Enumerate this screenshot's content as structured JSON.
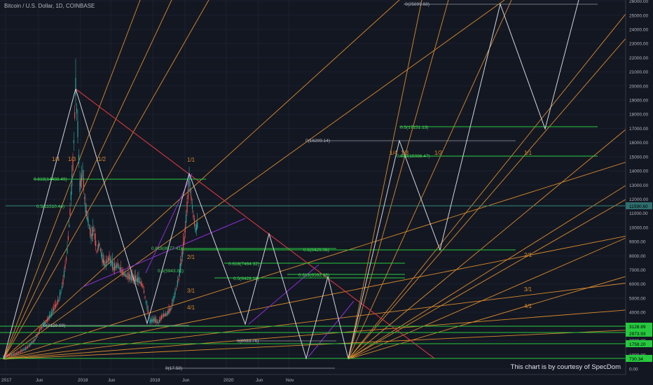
{
  "header": {
    "title": "Bitcoin / U.S. Dollar, 1D, COINBASE"
  },
  "footer": {
    "credit": "This chart is by courtesy of SpecDom"
  },
  "colors": {
    "background": "#131722",
    "price_candles_up": "#26a69a",
    "price_candles_down": "#ef5350",
    "fan": "#d98b2b",
    "fib_green": "#27c93f",
    "projection": "#d1d4dc",
    "trendline_red": "#d9363e",
    "channel_purple": "#8c2fd6",
    "current_price_label": "#2f6f6f"
  },
  "chart_data": {
    "type": "line",
    "title": "Bitcoin / U.S. Dollar, 1D, COINBASE",
    "xlabel": "",
    "ylabel": "",
    "ylim": [
      0,
      26000
    ],
    "x_tick_labels": [
      "2017",
      "Jun",
      "2018",
      "Jun",
      "2019",
      "Jun",
      "2020",
      "Jun",
      "Nov"
    ],
    "y_tick_labels": [
      "0.00",
      "1000.00",
      "2000.00",
      "3000.00",
      "4000.00",
      "5000.00",
      "6000.00",
      "7000.00",
      "8000.00",
      "9000.00",
      "10000.00",
      "11000.00",
      "12000.00",
      "13000.00",
      "14000.00",
      "15000.00",
      "16000.00",
      "17000.00",
      "18000.00",
      "19000.00",
      "20000.00",
      "21000.00",
      "22000.00",
      "23000.00",
      "24000.00",
      "25000.00",
      "26000.00"
    ],
    "price_labels": [
      {
        "text": "11590.60",
        "value": 11590.6,
        "color": "#2f6f6f"
      },
      {
        "text": "3128.89",
        "value": 3128.89,
        "color": "#27c93f"
      },
      {
        "text": "2973.93",
        "value": 2973.93,
        "color": "#27c93f"
      },
      {
        "text": "1758.20",
        "value": 1758.2,
        "color": "#27c93f"
      },
      {
        "text": "730.34",
        "value": 730.34,
        "color": "#27c93f"
      }
    ],
    "fan_labels": [
      "1/4",
      "1/3",
      "1/2",
      "1/1",
      "2/1",
      "3/1",
      "4/1"
    ],
    "fib_levels": [
      {
        "text": "0.618(14488.49)",
        "value": 14488.49
      },
      {
        "text": "0.5(11510.44)",
        "value": 11510.44
      },
      {
        "text": "0.618(8577.41)",
        "value": 8577.41
      },
      {
        "text": "0.5(5943.01)",
        "value": 5943.01
      },
      {
        "text": "0.618(7464.32)",
        "value": 7464.32
      },
      {
        "text": "0.5(6428.18)",
        "value": 6428.18
      },
      {
        "text": "0.5(8429.06)",
        "value": 8429.06
      },
      {
        "text": "0.618(6592.36)",
        "value": 6592.36
      },
      {
        "text": "0.5(17151.13)",
        "value": 17151.13
      },
      {
        "text": "0.618(15086.47)",
        "value": 15086.47
      }
    ],
    "zero_levels": [
      {
        "text": "0(3128.89)",
        "value": 3128.89
      },
      {
        "text": "0(2033.76)",
        "value": 2033.76
      },
      {
        "text": "0(17.58)",
        "value": 17.58
      },
      {
        "text": "0(16209.14)",
        "value": 16209.14
      },
      {
        "text": "0(25899.68)",
        "value": 25899.68
      }
    ],
    "price_history_points": [
      {
        "x": "2017",
        "y": 800
      },
      {
        "x": "Jun 2017",
        "y": 2600
      },
      {
        "x": "Dec 2017",
        "y": 19800
      },
      {
        "x": "Feb 2018",
        "y": 7000
      },
      {
        "x": "Jun 2018",
        "y": 6500
      },
      {
        "x": "Dec 2018",
        "y": 3200
      },
      {
        "x": "Jun 2019",
        "y": 13900
      },
      {
        "x": "Jul 2019",
        "y": 10000
      },
      {
        "x": "Aug 2019",
        "y": 11590
      }
    ]
  }
}
